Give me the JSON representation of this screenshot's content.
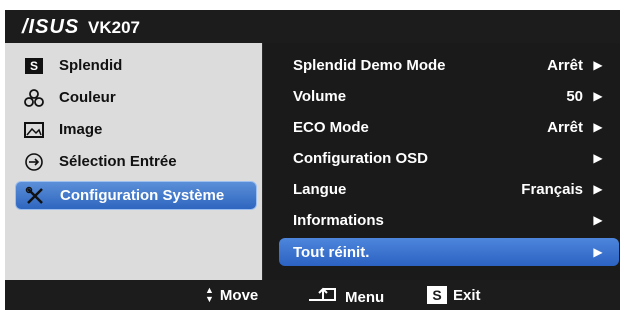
{
  "title": {
    "logo": "/ISUS",
    "model": "VK207"
  },
  "menu": [
    {
      "label": "Splendid",
      "icon": "s-box-icon"
    },
    {
      "label": "Couleur",
      "icon": "color-circles-icon"
    },
    {
      "label": "Image",
      "icon": "picture-icon"
    },
    {
      "label": "Sélection Entrée",
      "icon": "input-arrow-icon"
    },
    {
      "label": "Configuration Système",
      "icon": "tools-icon",
      "selected": true
    }
  ],
  "settings": [
    {
      "label": "Splendid Demo Mode",
      "value": "Arrêt"
    },
    {
      "label": "Volume",
      "value": "50"
    },
    {
      "label": "ECO Mode",
      "value": "Arrêt"
    },
    {
      "label": "Configuration OSD",
      "value": ""
    },
    {
      "label": "Langue",
      "value": "Français"
    },
    {
      "label": "Informations",
      "value": ""
    },
    {
      "label": "Tout réinit.",
      "value": "",
      "selected": true
    }
  ],
  "footer": {
    "move": "Move",
    "menu": "Menu",
    "exit": "Exit",
    "s_key": "S"
  },
  "colors": {
    "selection": "#2f66bf",
    "left_panel": "#dcdcdc",
    "right_panel": "#1a1a1a"
  }
}
